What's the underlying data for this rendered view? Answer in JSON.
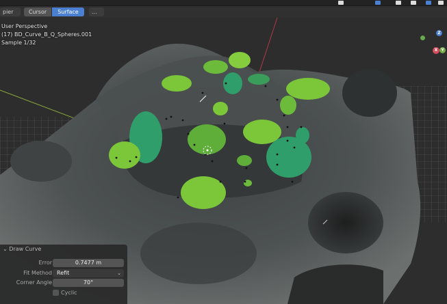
{
  "toolbar": {
    "left_field": "pier",
    "cursor_label": "Cursor",
    "surface_label": "Surface",
    "more_label": "..."
  },
  "viewport": {
    "view_name": "User Perspective",
    "object_name": "(17) BD_Curve_B_Q_Spheres.001",
    "sample": "Sample 1/32"
  },
  "gizmo": {
    "x_label": "X",
    "y_label": "Y",
    "z_label": "Z"
  },
  "panel": {
    "title": "Draw Curve",
    "error_label": "Error",
    "error_value": "0.7477 m",
    "fit_method_label": "Fit Method",
    "fit_method_value": "Refit",
    "corner_angle_label": "Corner Angle",
    "corner_angle_value": "70°",
    "cyclic_label": "Cyclic"
  },
  "colors": {
    "accent": "#4a7fd1",
    "moss_light": "#79c23a",
    "moss_teal": "#2f9e6a",
    "rock": "#5a5f5f"
  }
}
